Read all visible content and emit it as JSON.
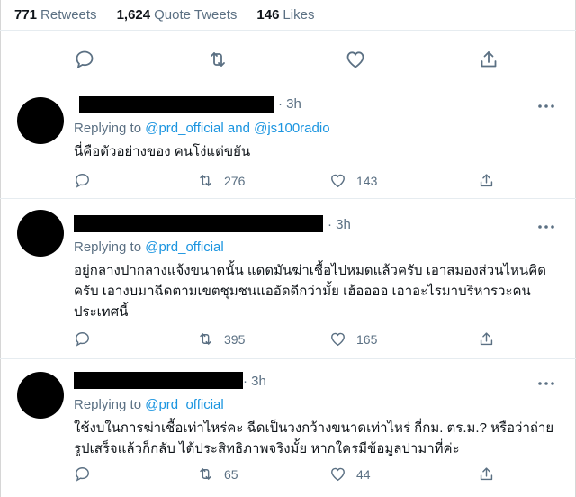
{
  "stats": {
    "retweets": {
      "value": "771",
      "label": "Retweets"
    },
    "quote_tweets": {
      "value": "1,624",
      "label": "Quote Tweets"
    },
    "likes": {
      "value": "146",
      "label": "Likes"
    }
  },
  "main_actions": [
    "reply-icon",
    "retweet-icon",
    "like-icon",
    "share-icon"
  ],
  "replies": [
    {
      "time": "· 3h",
      "replying_prefix": "Replying to",
      "handle1": "@prd_official",
      "conj": "and",
      "handle2": "@js100radio",
      "text": "นี่คือตัวอย่างของ คนโง่แต่ขยัน",
      "retweets": "276",
      "likes": "143"
    },
    {
      "time": "· 3h",
      "replying_prefix": "Replying to",
      "handle1": "@prd_official",
      "text": "อยู่กลางปากลางแจ้งขนาดนั้น แดดมันฆ่าเชื้อไปหมดแล้วครับ เอาสมองส่วนไหนคิดครับ เอางบมาฉีดตามเขตชุมชนแออัดดีกว่ามั้ย เฮ้ออออ เอาอะไรมาบริหารวะคนประเทศนี้",
      "retweets": "395",
      "likes": "165"
    },
    {
      "time": "· 3h",
      "replying_prefix": "Replying to",
      "handle1": "@prd_official",
      "text": "ใช้งบในการฆ่าเชื้อเท่าไหร่คะ ฉีดเป็นวงกว้างขนาดเท่าไหร่ กี่กม. ตร.ม.? หรือว่าถ่ายรูปเสร็จแล้วก็กลับ ได้ประสิทธิภาพจริงมั้ย หากใครมีข้อมูลปามาที่ค่ะ",
      "retweets": "65",
      "likes": "44"
    }
  ]
}
